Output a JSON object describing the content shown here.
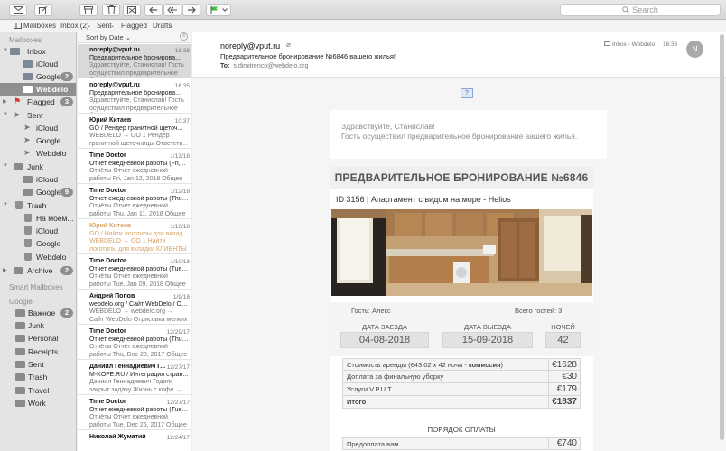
{
  "toolbar": {
    "search_placeholder": "Search"
  },
  "favorites": {
    "mailboxes": "Mailboxes",
    "inbox": "Inbox (2)",
    "sent": "Sent",
    "flagged": "Flagged",
    "drafts": "Drafts"
  },
  "sidebar": {
    "mailboxes_heading": "Mailboxes",
    "smart_heading": "Smart Mailboxes",
    "google_heading": "Google",
    "items": [
      {
        "label": "Inbox",
        "badge": ""
      },
      {
        "label": "iCloud",
        "badge": ""
      },
      {
        "label": "Google",
        "badge": "2"
      },
      {
        "label": "Webdelo",
        "badge": ""
      },
      {
        "label": "Flagged",
        "badge": "3"
      },
      {
        "label": "Sent",
        "badge": ""
      },
      {
        "label": "iCloud",
        "badge": ""
      },
      {
        "label": "Google",
        "badge": ""
      },
      {
        "label": "Webdelo",
        "badge": ""
      },
      {
        "label": "Junk",
        "badge": ""
      },
      {
        "label": "iCloud",
        "badge": ""
      },
      {
        "label": "Google",
        "badge": "9"
      },
      {
        "label": "Trash",
        "badge": ""
      },
      {
        "label": "На моем...",
        "badge": ""
      },
      {
        "label": "iCloud",
        "badge": ""
      },
      {
        "label": "Google",
        "badge": ""
      },
      {
        "label": "Webdelo",
        "badge": ""
      },
      {
        "label": "Archive",
        "badge": "2"
      }
    ],
    "google_folders": [
      {
        "label": "Важное",
        "badge": "2"
      },
      {
        "label": "Junk",
        "badge": ""
      },
      {
        "label": "Personal",
        "badge": ""
      },
      {
        "label": "Receipts",
        "badge": ""
      },
      {
        "label": "Sent",
        "badge": ""
      },
      {
        "label": "Trash",
        "badge": ""
      },
      {
        "label": "Travel",
        "badge": ""
      },
      {
        "label": "Work",
        "badge": ""
      }
    ]
  },
  "message_list": {
    "sort_label": "Sort by Date",
    "messages": [
      {
        "from": "noreply@vput.ru",
        "date": "16:38",
        "subject": "Предварительное бронирова...",
        "preview": "Здравствуйте, Станислав! Гость осуществил предварительное бр..."
      },
      {
        "from": "noreply@vput.ru",
        "date": "16:35",
        "subject": "Предварительное бронирова...",
        "preview": "Здравствуйте, Станислав! Гость осуществил предварительное бр..."
      },
      {
        "from": "Юрий Китаев",
        "date": "10:37",
        "subject": "GO / Рендер гранитной щеточ...",
        "preview": "WEBDELO → GO 1 Рендер гранитной щеточницы Ответств..."
      },
      {
        "from": "Time Doctor",
        "date": "1/13/18",
        "subject": "Отчет ежедневной работы (Fri,...",
        "preview": "Отчёты Отчет ежедневной работы Fri, Jan 12, 2018 Общее п..."
      },
      {
        "from": "Time Doctor",
        "date": "1/12/18",
        "subject": "Отчет ежедневной работы (Thu,...",
        "preview": "Отчёты Отчет ежедневной работы Thu, Jan 11, 2018 Общее п..."
      },
      {
        "from": "Юрий Китаев",
        "date": "1/10/18",
        "subject": "GO / Найти логотипы для вклад...",
        "preview": "WEBDELO → GO 1 Найти логотипы для вкладки КЛИЕНТЫ Ответств..."
      },
      {
        "from": "Time Doctor",
        "date": "1/10/18",
        "subject": "Отчет ежедневной работы (Tue,...",
        "preview": "Отчёты Отчет ежедневной работы Tue, Jan 09, 2018 Общее п..."
      },
      {
        "from": "Андрей Попов",
        "date": "1/9/18",
        "subject": "webdelo.org / Сайт WebDelo / Отр...",
        "preview": "WEBDELO → webdelo.org → Сайт WebDelo Отрисовка мелких элем..."
      },
      {
        "from": "Time Doctor",
        "date": "12/29/17",
        "subject": "Отчет ежедневной работы (Thu,...",
        "preview": "Отчёты Отчет ежедневной работы Thu, Dec 28, 2017 Общее п..."
      },
      {
        "from": "Даниил Геннадиевич Г...",
        "date": "12/27/17",
        "subject": "M-KOFE.RU / Интеграция стран...",
        "preview": "Даниил Геннадиевич Годияк закрыт задачу Жизнь с кофе →..."
      },
      {
        "from": "Time Doctor",
        "date": "12/27/17",
        "subject": "Отчет ежедневной работы (Tue,...",
        "preview": "Отчёты Отчет ежедневной работы Tue, Dec 26, 2017 Общее п..."
      },
      {
        "from": "Николай Жуматий",
        "date": "12/24/17",
        "subject": "",
        "preview": ""
      }
    ]
  },
  "reader": {
    "from": "noreply@vput.ru",
    "subject": "Предварительное бронирование №6846 вашего жилья!",
    "to_label": "To:",
    "to_address": "s.dimitrenco@webdelo.org",
    "mailbox": "Inbox - Webdelo",
    "time": "16:38",
    "avatar_letter": "N",
    "image_placeholder": "?",
    "greeting_line1": "Здравствуйте, Станислав!",
    "greeting_line2": "Гость осуществил предварительное бронирование вашего жилья.",
    "card_title": "ПРЕДВАРИТЕЛЬНОЕ БРОНИРОВАНИЕ №6846",
    "id_line": "ID 3156   |   Апартамент с видом на море - Helios",
    "guest_label": "Гость: Алекс",
    "guests_count_label": "Всего гостей: 3",
    "checkin_label": "ДАТА ЗАЕЗДА",
    "checkin_value": "04-08-2018",
    "checkout_label": "ДАТА ВЫЕЗДА",
    "checkout_value": "15-09-2018",
    "nights_label": "НОЧЕЙ",
    "nights_value": "42",
    "price_rows": [
      {
        "label": "Стоимость аренды (€43.02 x 42 ночи - ",
        "bold": "комиссия",
        "suffix": ")",
        "value": "€1628"
      },
      {
        "label": "Доплата за финальную уборку",
        "bold": "",
        "suffix": "",
        "value": "€30"
      },
      {
        "label": "Услуги V.P.U.T.",
        "bold": "",
        "suffix": "",
        "value": "€179"
      },
      {
        "label": "Итого",
        "bold": "",
        "suffix": "",
        "value": "€1837"
      }
    ],
    "order_title": "ПОРЯДОК ОПЛАТЫ",
    "order_row_label": "Предоплата вам",
    "order_row_value": "€740"
  }
}
